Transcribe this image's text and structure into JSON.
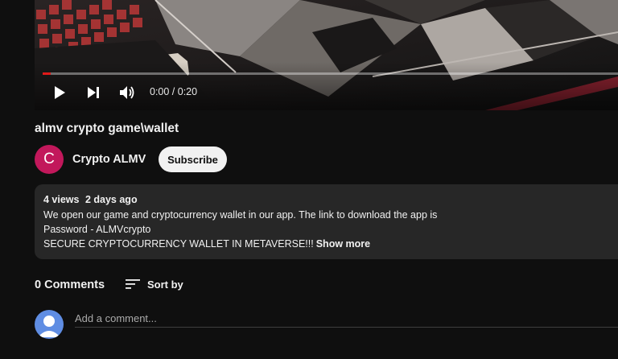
{
  "player": {
    "current_time": "0:00",
    "duration": "0:20",
    "time_display": "0:00 / 0:20",
    "progress_fraction": 0.0,
    "accent_color": "#ff0000",
    "icons": {
      "play": "play-icon",
      "next": "next-icon",
      "volume": "volume-icon"
    }
  },
  "video": {
    "title": "almv crypto game\\wallet"
  },
  "channel": {
    "avatar_letter": "C",
    "avatar_color": "#c2185b",
    "name": "Crypto ALMV",
    "subscribe_label": "Subscribe"
  },
  "description": {
    "views": "4 views",
    "date": "2 days ago",
    "lines": [
      "We open our game and cryptocurrency wallet in our app. The link to download the app is",
      "Password - ALMVcrypto",
      "SECURE CRYPTOCURRENCY WALLET IN METAVERSE!!!"
    ],
    "show_more_label": "Show more"
  },
  "comments": {
    "count_label": "0 Comments",
    "sort_label": "Sort by",
    "sort_icon": "sort-icon",
    "input_placeholder": "Add a comment...",
    "user_avatar_icon": "user-avatar-icon",
    "user_avatar_color": "#5f8de3"
  }
}
